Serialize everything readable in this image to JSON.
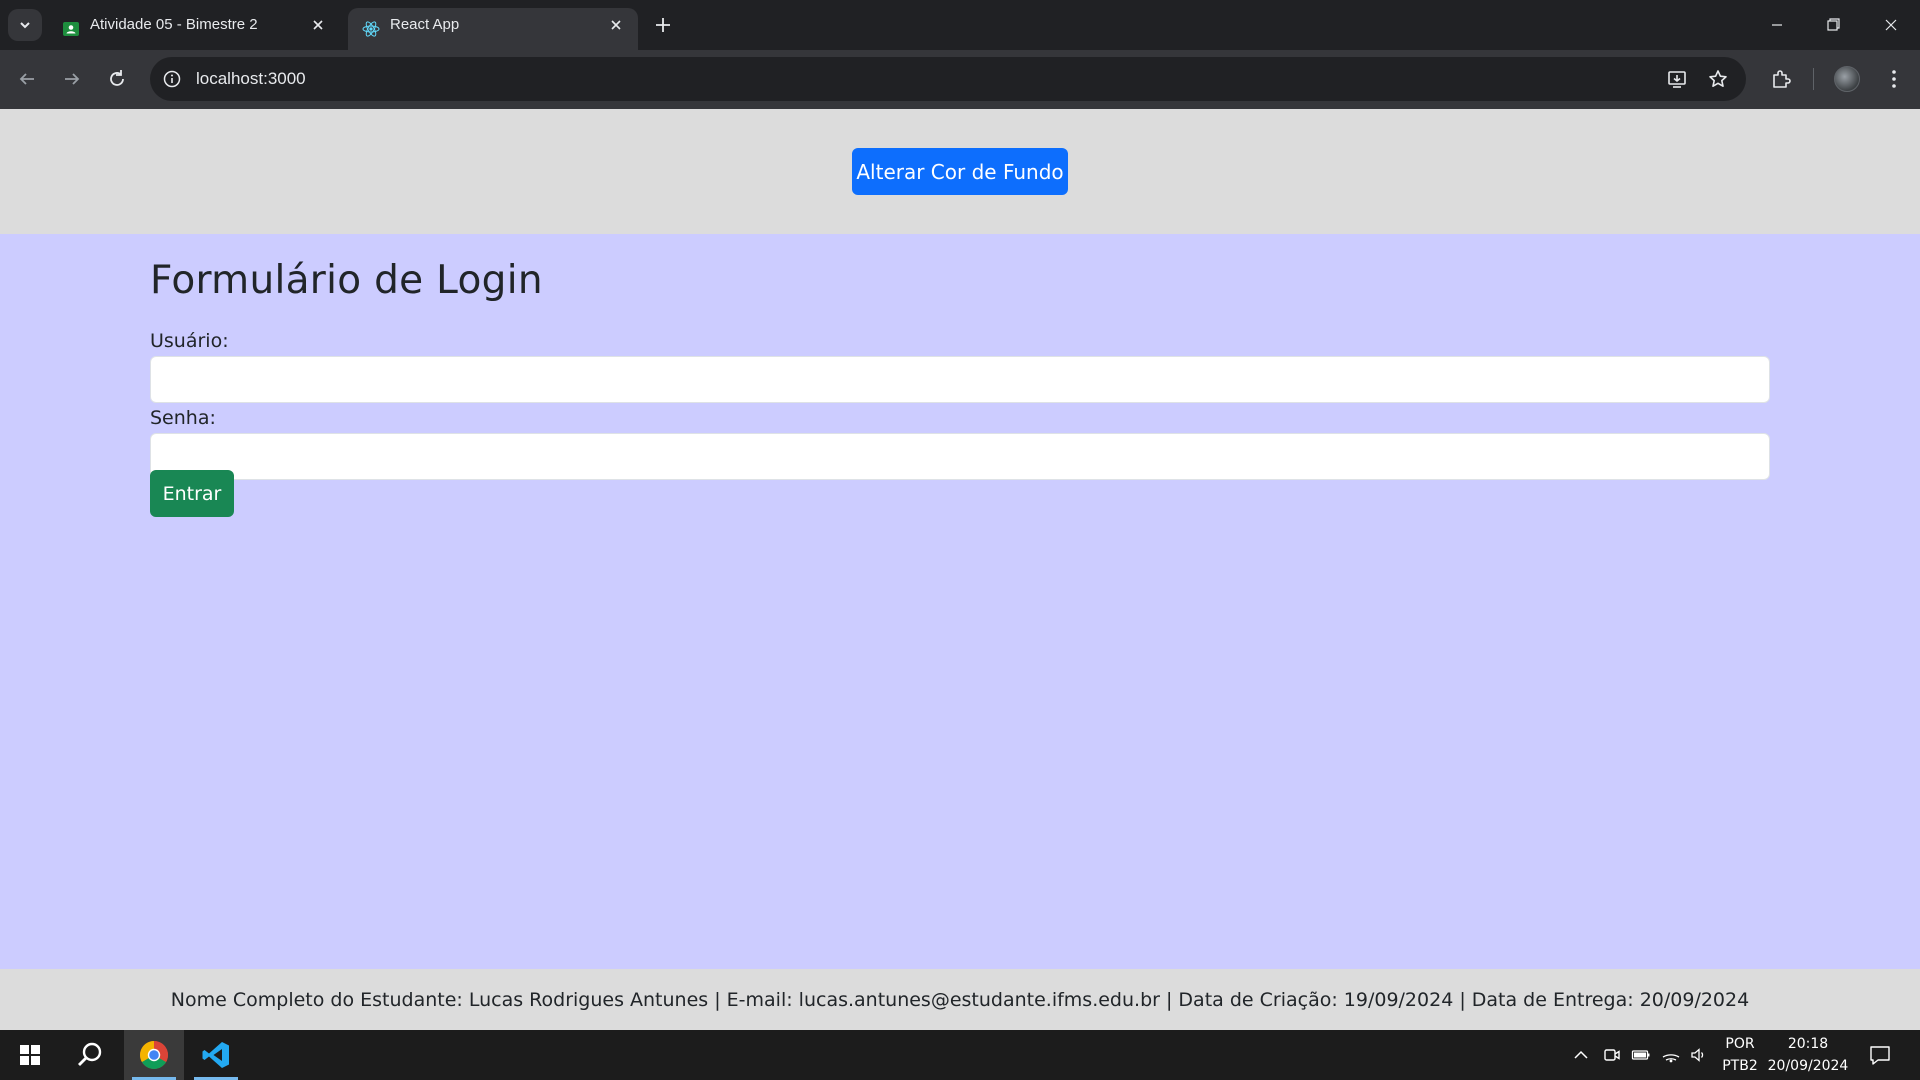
{
  "browser": {
    "tabs": [
      {
        "title": "Atividade 05 - Bimestre 2",
        "icon": "google-classroom-icon",
        "active": false
      },
      {
        "title": "React App",
        "icon": "react-icon",
        "active": true
      }
    ],
    "url": "localhost:3000"
  },
  "page": {
    "background_color": "#ccccff",
    "change_bg_button": "Alterar Cor de Fundo",
    "form": {
      "title": "Formulário de Login",
      "user_label": "Usuário:",
      "user_value": "",
      "password_label": "Senha:",
      "password_value": "",
      "submit_label": "Entrar"
    },
    "footer": "Nome Completo do Estudante: Lucas Rodrigues Antunes | E-mail: lucas.antunes@estudante.ifms.edu.br | Data de Criação: 19/09/2024 | Data de Entrega: 20/09/2024"
  },
  "taskbar": {
    "apps": [
      "start-icon",
      "search-icon",
      "chrome-icon",
      "vscode-icon"
    ],
    "lang_top": "POR",
    "lang_bottom": "PTB2",
    "time": "20:18",
    "date": "20/09/2024"
  },
  "colors": {
    "primary": "#0d6efd",
    "success": "#198754",
    "header_footer_bg": "#dcdcdc"
  }
}
